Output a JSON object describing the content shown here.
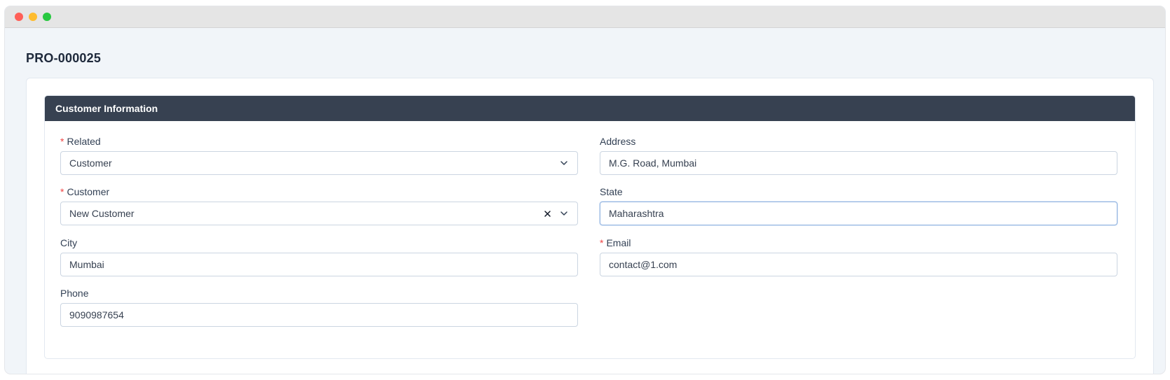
{
  "window": {
    "controls": [
      "close",
      "minimize",
      "maximize"
    ]
  },
  "page": {
    "title": "PRO-000025"
  },
  "section": {
    "title": "Customer Information"
  },
  "fields": {
    "related": {
      "label": "Related",
      "required": true,
      "value": "Customer",
      "type": "select",
      "icon": "chevron-down-icon"
    },
    "customer": {
      "label": "Customer",
      "required": true,
      "value": "New Customer",
      "type": "select",
      "icons": [
        "clear-icon",
        "chevron-down-icon"
      ]
    },
    "city": {
      "label": "City",
      "required": false,
      "value": "Mumbai",
      "type": "text"
    },
    "phone": {
      "label": "Phone",
      "required": false,
      "value": "9090987654",
      "type": "text"
    },
    "address": {
      "label": "Address",
      "required": false,
      "value": "M.G. Road, Mumbai",
      "type": "text"
    },
    "state": {
      "label": "State",
      "required": false,
      "value": "Maharashtra",
      "type": "text",
      "focused": true
    },
    "email": {
      "label": "Email",
      "required": true,
      "value": "contact@1.com",
      "type": "text"
    }
  },
  "required_marker": "*",
  "colors": {
    "header_bg": "#374151",
    "required": "#ef4444",
    "page_bg": "#f1f5f9"
  }
}
